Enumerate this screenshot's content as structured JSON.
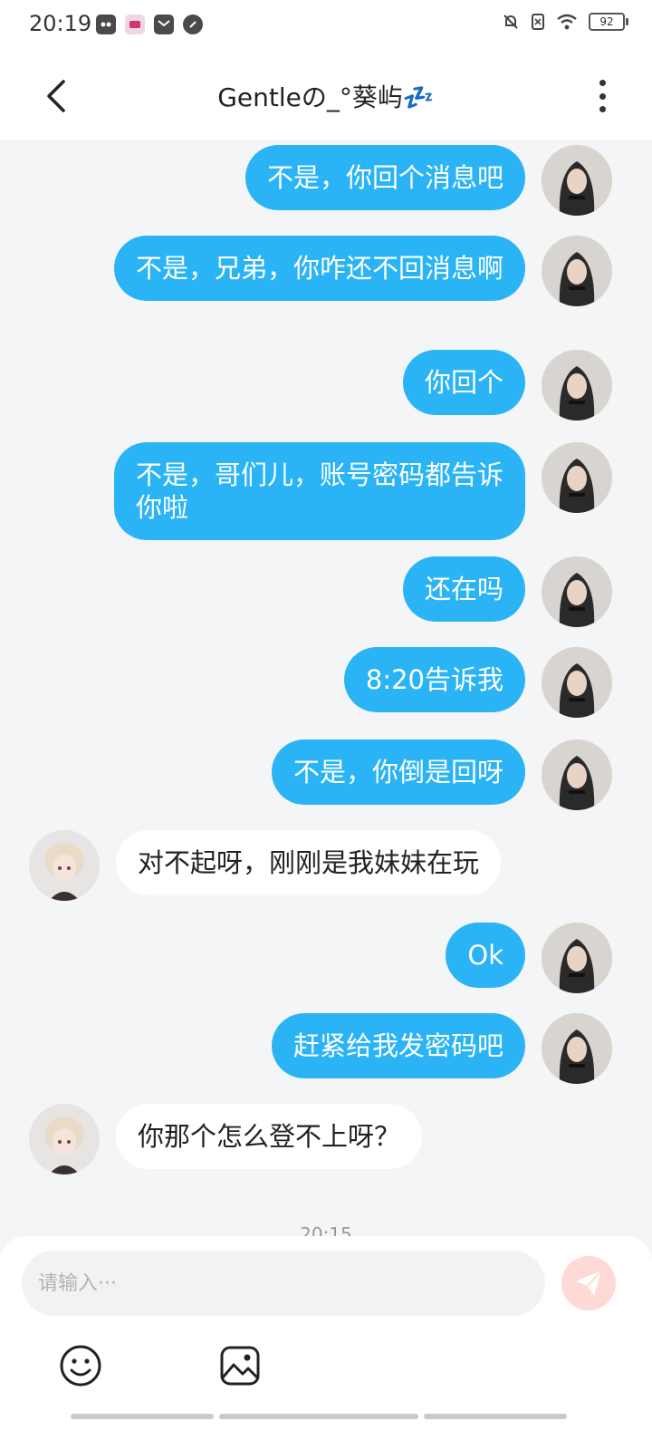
{
  "status_bar": {
    "time": "20:19",
    "battery": "92"
  },
  "header": {
    "title": "Gentleの_°葵屿💤"
  },
  "messages": [
    {
      "sender": "me",
      "text": "不是，你回个消息吧"
    },
    {
      "sender": "me",
      "text": "不是，兄弟，你咋还不回消息啊"
    },
    {
      "sender": "me",
      "text": "你回个"
    },
    {
      "sender": "me",
      "text": "不是，哥们儿，账号密码都告诉你啦"
    },
    {
      "sender": "me",
      "text": "还在吗"
    },
    {
      "sender": "me",
      "text": "8:20告诉我"
    },
    {
      "sender": "me",
      "text": "不是，你倒是回呀"
    },
    {
      "sender": "other",
      "text": "对不起呀，刚刚是我妹妹在玩"
    },
    {
      "sender": "me",
      "text": "Ok"
    },
    {
      "sender": "me",
      "text": "赶紧给我发密码吧"
    },
    {
      "sender": "other",
      "text": "你那个怎么登不上呀？"
    }
  ],
  "time_separator": "20:15",
  "composer": {
    "placeholder": "请输入···"
  },
  "colors": {
    "my_bubble": "#2ab4f5",
    "other_bubble": "#ffffff",
    "send_button": "#ffd9d6"
  }
}
